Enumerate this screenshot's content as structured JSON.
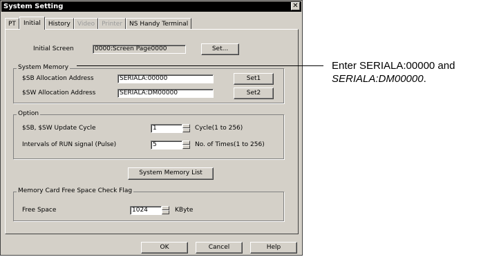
{
  "window": {
    "title": "System Setting",
    "close_glyph": "✕"
  },
  "tabs": [
    {
      "label": "PT",
      "active": false,
      "disabled": false
    },
    {
      "label": "Initial",
      "active": true,
      "disabled": false
    },
    {
      "label": "History",
      "active": false,
      "disabled": false
    },
    {
      "label": "Video",
      "active": false,
      "disabled": true
    },
    {
      "label": "Printer",
      "active": false,
      "disabled": true
    },
    {
      "label": "NS Handy Terminal",
      "active": false,
      "disabled": false
    }
  ],
  "initial_screen": {
    "label": "Initial Screen",
    "value": "0000:Screen Page0000",
    "button": "Set..."
  },
  "system_memory": {
    "title": "System Memory",
    "sb": {
      "label": "$SB Allocation Address",
      "value": "SERIALA:00000",
      "button": "Set1"
    },
    "sw": {
      "label": "$SW Allocation Address",
      "value": "SERIALA:DM00000",
      "button": "Set2"
    }
  },
  "option": {
    "title": "Option",
    "update_cycle": {
      "label": "$SB, $SW Update Cycle",
      "value": "1",
      "unit": "Cycle(1 to 256)"
    },
    "run_interval": {
      "label": "Intervals of RUN signal (Pulse)",
      "value": "5",
      "unit": "No. of Times(1 to 256)"
    }
  },
  "system_memory_list_button": "System Memory List",
  "memory_card": {
    "title": "Memory Card Free Space Check Flag",
    "label": "Free Space",
    "value": "1024",
    "unit": "KByte"
  },
  "footer": {
    "ok": "OK",
    "cancel": "Cancel",
    "help": "Help"
  },
  "callout": {
    "line1": "Enter SERIALA:00000 and",
    "line2": "SERIALA:DM00000",
    "line2_suffix": "."
  }
}
